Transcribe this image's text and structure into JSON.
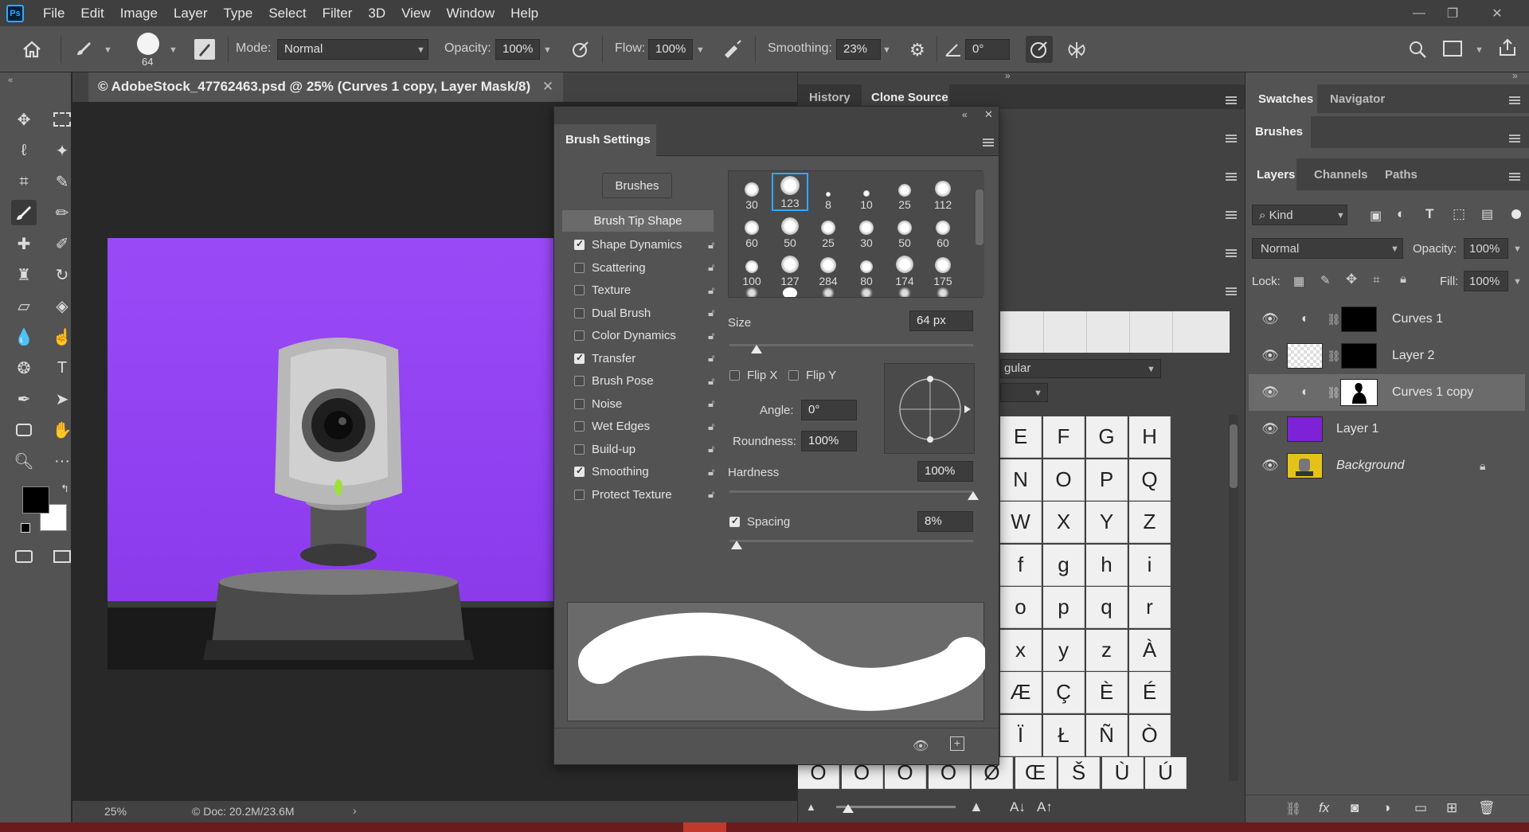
{
  "menubar": {
    "items": [
      "File",
      "Edit",
      "Image",
      "Layer",
      "Type",
      "Select",
      "Filter",
      "3D",
      "View",
      "Window",
      "Help"
    ]
  },
  "options": {
    "brush_size": "64",
    "mode_label": "Mode:",
    "mode_value": "Normal",
    "opacity_label": "Opacity:",
    "opacity_value": "100%",
    "flow_label": "Flow:",
    "flow_value": "100%",
    "smoothing_label": "Smoothing:",
    "smoothing_value": "23%",
    "angle_value": "0°"
  },
  "document": {
    "tab_title": "© AdobeStock_47762463.psd @ 25% (Curves 1 copy, Layer Mask/8)",
    "zoom": "25%",
    "doc_info": "© Doc: 20.2M/23.6M"
  },
  "mid_panel": {
    "tabs": [
      "History",
      "Clone Source"
    ],
    "style_value": "gular",
    "glyph_rows": [
      [
        "E",
        "F",
        "G",
        "H"
      ],
      [
        "N",
        "O",
        "P",
        "Q"
      ],
      [
        "W",
        "X",
        "Y",
        "Z"
      ],
      [
        "f",
        "g",
        "h",
        "i"
      ],
      [
        "o",
        "p",
        "q",
        "r"
      ],
      [
        "x",
        "y",
        "z",
        "À"
      ],
      [
        "Æ",
        "Ç",
        "È",
        "É"
      ],
      [
        "Ï",
        "Ł",
        "Ñ",
        "Ò"
      ]
    ],
    "glyph_bottom_row": [
      "Ó",
      "Ô",
      "Õ",
      "Ö",
      "Ø",
      "Œ",
      "Š",
      "Ù",
      "Ú"
    ]
  },
  "brush_panel": {
    "title": "Brush Settings",
    "brushes_button": "Brushes",
    "tip_shape_label": "Brush Tip Shape",
    "options": [
      {
        "label": "Shape Dynamics",
        "checked": true
      },
      {
        "label": "Scattering",
        "checked": false
      },
      {
        "label": "Texture",
        "checked": false
      },
      {
        "label": "Dual Brush",
        "checked": false
      },
      {
        "label": "Color Dynamics",
        "checked": false
      },
      {
        "label": "Transfer",
        "checked": true
      },
      {
        "label": "Brush Pose",
        "checked": false
      },
      {
        "label": "Noise",
        "checked": false
      },
      {
        "label": "Wet Edges",
        "checked": false
      },
      {
        "label": "Build-up",
        "checked": false
      },
      {
        "label": "Smoothing",
        "checked": true
      },
      {
        "label": "Protect Texture",
        "checked": false
      }
    ],
    "tips": [
      "30",
      "123",
      "8",
      "10",
      "25",
      "112",
      "60",
      "50",
      "25",
      "30",
      "50",
      "60",
      "100",
      "127",
      "284",
      "80",
      "174",
      "175"
    ],
    "size_label": "Size",
    "size_value": "64 px",
    "size_slider": 0.11,
    "flipx_label": "Flip X",
    "flipy_label": "Flip Y",
    "angle_label": "Angle:",
    "angle_value": "0°",
    "roundness_label": "Roundness:",
    "roundness_value": "100%",
    "hardness_label": "Hardness",
    "hardness_value": "100%",
    "hardness_slider": 1.0,
    "spacing_label": "Spacing",
    "spacing_value": "8%",
    "spacing_slider": 0.03
  },
  "right_panel": {
    "top_tabs": [
      "Swatches",
      "Navigator"
    ],
    "brushes_tab": "Brushes",
    "layer_tabs": [
      "Layers",
      "Channels",
      "Paths"
    ],
    "kind_label": "Kind",
    "blend_mode": "Normal",
    "opacity_label": "Opacity:",
    "opacity_value": "100%",
    "lock_label": "Lock:",
    "fill_label": "Fill:",
    "fill_value": "100%",
    "layers": [
      {
        "name": "Curves 1",
        "selected": false
      },
      {
        "name": "Layer 2",
        "selected": false
      },
      {
        "name": "Curves 1 copy",
        "selected": true
      },
      {
        "name": "Layer 1",
        "selected": false
      },
      {
        "name": "Background",
        "selected": false
      }
    ]
  },
  "colors": {
    "accent": "#31a8ff",
    "canvas_purple": "#9a4af5",
    "layer1_purple": "#7d22d6"
  }
}
